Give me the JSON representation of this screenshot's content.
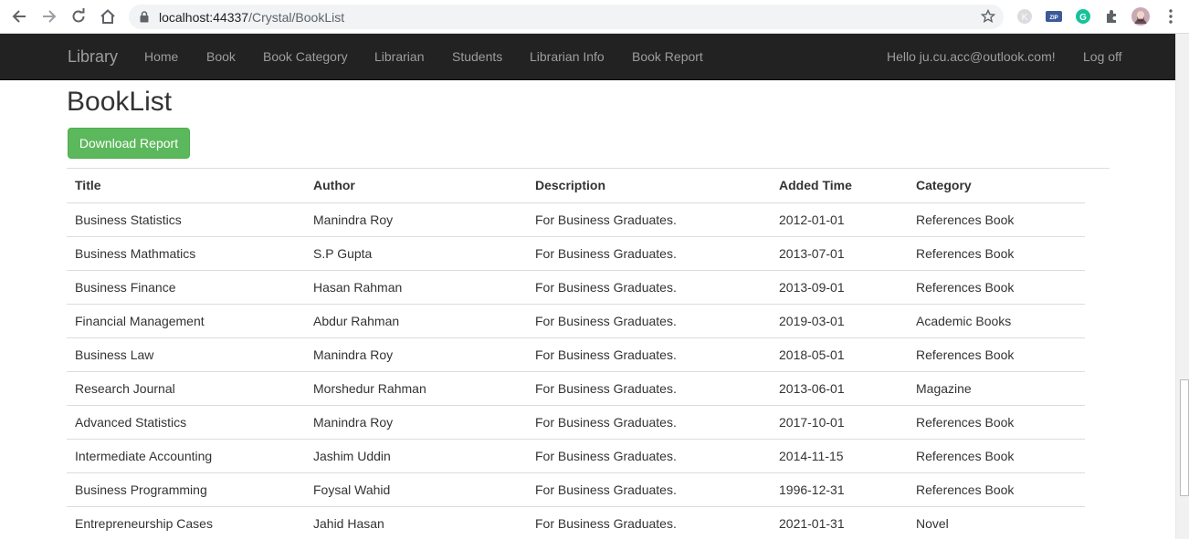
{
  "browser": {
    "url_host": "localhost:44337",
    "url_path": "/Crystal/BookList",
    "ext_zip_label": "ZIP",
    "ext_k_label": "K",
    "ext_g_label": "G"
  },
  "navbar": {
    "brand": "Library",
    "items": [
      {
        "label": "Home"
      },
      {
        "label": "Book"
      },
      {
        "label": "Book Category"
      },
      {
        "label": "Librarian"
      },
      {
        "label": "Students"
      },
      {
        "label": "Librarian Info"
      },
      {
        "label": "Book Report"
      }
    ],
    "greeting": "Hello ju.cu.acc@outlook.com!",
    "logoff": "Log off"
  },
  "page": {
    "title": "BookList",
    "download_label": "Download Report"
  },
  "table": {
    "headers": [
      "Title",
      "Author",
      "Description",
      "Added Time",
      "Category"
    ],
    "rows": [
      [
        "Business Statistics",
        "Manindra Roy",
        "For Business Graduates.",
        "2012-01-01",
        "References Book"
      ],
      [
        "Business Mathmatics",
        "S.P Gupta",
        "For Business Graduates.",
        "2013-07-01",
        "References Book"
      ],
      [
        "Business Finance",
        "Hasan Rahman",
        "For Business Graduates.",
        "2013-09-01",
        "References Book"
      ],
      [
        "Financial Management",
        "Abdur Rahman",
        "For Business Graduates.",
        "2019-03-01",
        "Academic Books"
      ],
      [
        "Business Law",
        "Manindra Roy",
        "For Business Graduates.",
        "2018-05-01",
        "References Book"
      ],
      [
        "Research Journal",
        "Morshedur Rahman",
        "For Business Graduates.",
        "2013-06-01",
        "Magazine"
      ],
      [
        "Advanced Statistics",
        "Manindra Roy",
        "For Business Graduates.",
        "2017-10-01",
        "References Book"
      ],
      [
        "Intermediate Accounting",
        "Jashim Uddin",
        "For Business Graduates.",
        "2014-11-15",
        "References Book"
      ],
      [
        "Business Programming",
        "Foysal Wahid",
        "For Business Graduates.",
        "1996-12-31",
        "References Book"
      ],
      [
        "Entrepreneurship Cases",
        "Jahid Hasan",
        "For Business Graduates.",
        "2021-01-31",
        "Novel"
      ]
    ]
  },
  "colors": {
    "navbar_bg": "#222222",
    "nav_text": "#9d9d9d",
    "success_button": "#5cb85c"
  }
}
